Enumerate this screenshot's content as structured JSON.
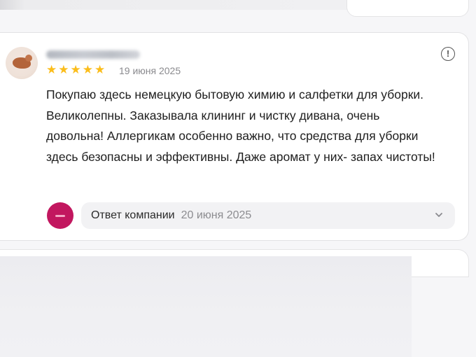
{
  "review": {
    "rating": 5,
    "stars": [
      "★",
      "★",
      "★",
      "★",
      "★"
    ],
    "date": "19 июня 2025",
    "text": "Покупаю здесь немецкую бытовую химию и салфетки для уборки. Великолепны. Заказывала клининг и чистку дивана, очень довольна! Аллергикам особенно важно, что средства для уборки здесь безопасны и эффективны. Даже аромат у них- запах чистоты!",
    "info_glyph": "!"
  },
  "company_answer": {
    "label": "Ответ компании",
    "date": "20 июня 2025",
    "chevron_icon": "chevron-down-icon"
  },
  "colors": {
    "star": "#fbbd1b",
    "company_logo": "#c2175f"
  }
}
